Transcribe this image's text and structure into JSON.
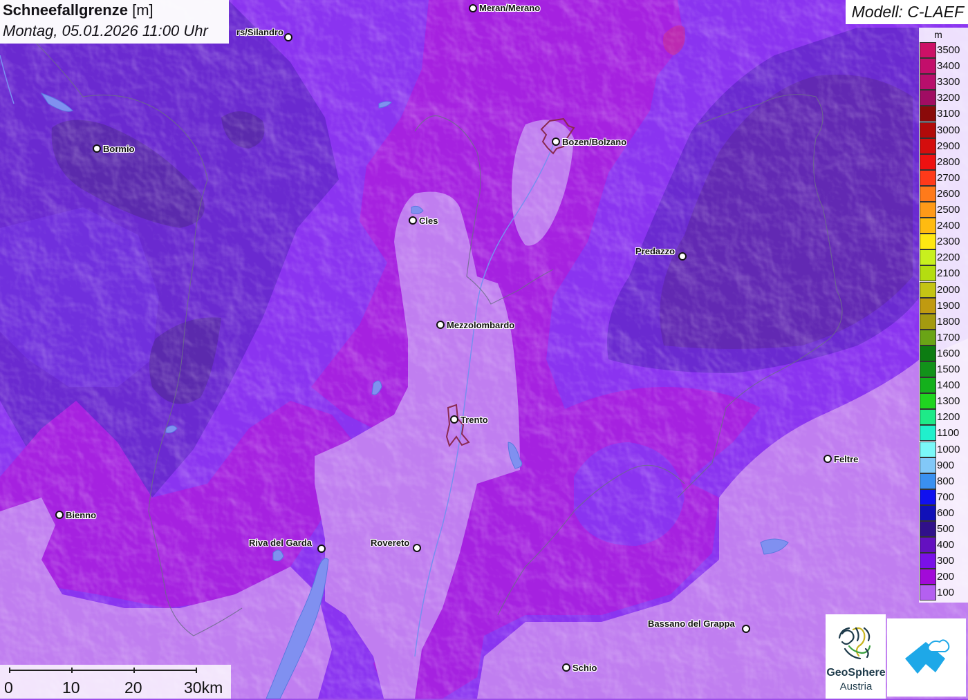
{
  "header": {
    "title_bold": "Schneefallgrenze",
    "title_unit": "[m]",
    "datetime": "Montag, 05.01.2026 11:00 Uhr"
  },
  "model": {
    "label": "Modell: C-LAEF"
  },
  "legend": {
    "unit": "m",
    "items": [
      {
        "label": "3500",
        "color": "#cc1066"
      },
      {
        "label": "3400",
        "color": "#c30e6b"
      },
      {
        "label": "3300",
        "color": "#b80e6c"
      },
      {
        "label": "3200",
        "color": "#a10c63"
      },
      {
        "label": "3100",
        "color": "#8a0a0a"
      },
      {
        "label": "3000",
        "color": "#b20a0a"
      },
      {
        "label": "2900",
        "color": "#d40d0d"
      },
      {
        "label": "2800",
        "color": "#ee1111"
      },
      {
        "label": "2700",
        "color": "#ff3a1a"
      },
      {
        "label": "2600",
        "color": "#ff7a1a"
      },
      {
        "label": "2500",
        "color": "#ff9a18"
      },
      {
        "label": "2400",
        "color": "#ffbb10"
      },
      {
        "label": "2300",
        "color": "#ffe812"
      },
      {
        "label": "2200",
        "color": "#c8f01e"
      },
      {
        "label": "2100",
        "color": "#b4dd10"
      },
      {
        "label": "2000",
        "color": "#c4c414"
      },
      {
        "label": "1900",
        "color": "#c09a10"
      },
      {
        "label": "1800",
        "color": "#a49a10"
      },
      {
        "label": "1700",
        "color": "#6aa416"
      },
      {
        "label": "1600",
        "color": "#0c7c12"
      },
      {
        "label": "1500",
        "color": "#12921a"
      },
      {
        "label": "1400",
        "color": "#14b01c"
      },
      {
        "label": "1300",
        "color": "#20d420"
      },
      {
        "label": "1200",
        "color": "#1eea88"
      },
      {
        "label": "1100",
        "color": "#20f0cc"
      },
      {
        "label": "1000",
        "color": "#7af8f8"
      },
      {
        "label": "900",
        "color": "#82c8f8"
      },
      {
        "label": "800",
        "color": "#3a90f0"
      },
      {
        "label": "700",
        "color": "#1010f0"
      },
      {
        "label": "600",
        "color": "#1010b8"
      },
      {
        "label": "500",
        "color": "#30108a"
      },
      {
        "label": "400",
        "color": "#6410c0"
      },
      {
        "label": "300",
        "color": "#7a10e8"
      },
      {
        "label": "200",
        "color": "#a20ad8"
      },
      {
        "label": "100",
        "color": "#b460f0"
      }
    ]
  },
  "cities": [
    {
      "name": "Meran/Merano"
    },
    {
      "name": "rs/Silandro"
    },
    {
      "name": "Bormio"
    },
    {
      "name": "Bozen/Bolzano"
    },
    {
      "name": "Cles"
    },
    {
      "name": "Predazzo"
    },
    {
      "name": "Mezzolombardo"
    },
    {
      "name": "Trento"
    },
    {
      "name": "Feltre"
    },
    {
      "name": "Bienno"
    },
    {
      "name": "Riva del Garda"
    },
    {
      "name": "Rovereto"
    },
    {
      "name": "Bassano del Grappa"
    },
    {
      "name": "Schio"
    }
  ],
  "scale_bar": {
    "labels": [
      "0",
      "10",
      "20",
      "30km"
    ]
  },
  "logos": {
    "geosphere_line1": "GeoSphere",
    "geosphere_line2": "Austria"
  }
}
